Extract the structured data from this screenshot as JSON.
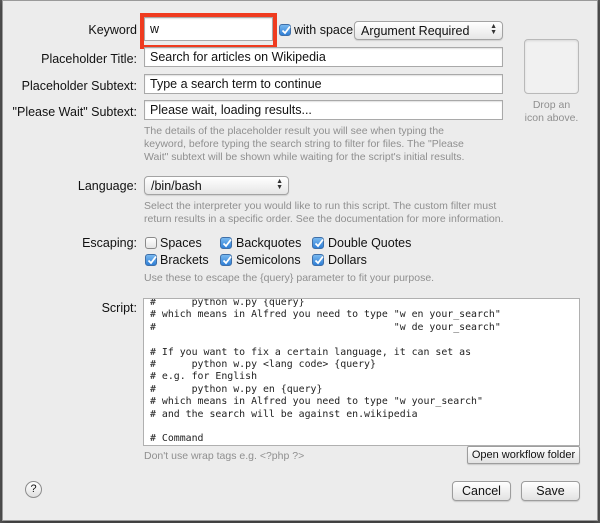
{
  "keyword": {
    "label": "Keyword",
    "value": "w"
  },
  "with_space": {
    "label": "with space",
    "checked": true
  },
  "argument_popup": {
    "selected": "Argument Required"
  },
  "placeholder_title": {
    "label": "Placeholder Title:",
    "value": "Search for articles on Wikipedia"
  },
  "placeholder_subtext": {
    "label": "Placeholder Subtext:",
    "value": "Type a search term to continue"
  },
  "please_wait": {
    "label": "\"Please Wait\" Subtext:",
    "value": "Please wait, loading results..."
  },
  "placeholder_help": [
    "The details of the placeholder result you will see when typing the",
    "keyword, before typing the search string to filter for files. The \"Please",
    "Wait\" subtext will be shown while waiting for the script's initial results."
  ],
  "icon_drop": {
    "line1": "Drop an",
    "line2": "icon above."
  },
  "language": {
    "label": "Language:",
    "selected": "/bin/bash"
  },
  "language_help": [
    "Select the interpreter you would like to run this script. The custom filter must",
    "return results in a specific order. See the documentation for more information."
  ],
  "escaping": {
    "label": "Escaping:",
    "options": {
      "spaces": {
        "label": "Spaces",
        "checked": false
      },
      "backquotes": {
        "label": "Backquotes",
        "checked": true
      },
      "double_quotes": {
        "label": "Double Quotes",
        "checked": true
      },
      "brackets": {
        "label": "Brackets",
        "checked": true
      },
      "semicolons": {
        "label": "Semicolons",
        "checked": true
      },
      "dollars": {
        "label": "Dollars",
        "checked": true
      }
    },
    "help": "Use these to escape the {query} parameter to fit your purpose."
  },
  "script": {
    "label": "Script:",
    "code": "#      python w.py {query}\n# which means in Alfred you need to type \"w en your_search\"\n#                                        \"w de your_search\"\n\n# If you want to fix a certain language, it can set as\n#      python w.py <lang code> {query}\n# e.g. for English\n#      python w.py en {query}\n# which means in Alfred you need to type \"w your_search\"\n# and the search will be against en.wikipedia\n\n# Command\npython w.py jp {query}",
    "help": "Don't use wrap tags e.g. <?php ?>"
  },
  "buttons": {
    "open_folder": "Open workflow folder",
    "cancel": "Cancel",
    "save": "Save",
    "help": "?"
  }
}
